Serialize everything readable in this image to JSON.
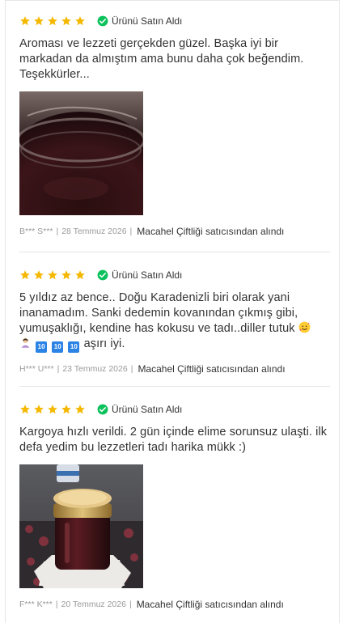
{
  "reviews": [
    {
      "rating": 5,
      "verified_label": "Ürünü Satın Aldı",
      "comment": "Aroması ve lezzeti gerçekden güzel. Başka iyi bir markadan da almıştım ama bunu daha çok beğendim. Teşekkürler...",
      "has_photo": true,
      "user": "B*** S***",
      "date": "28 Temmuz 2026",
      "seller": "Macahel Çiftliği satıcısından alındı"
    },
    {
      "rating": 5,
      "verified_label": "Ürünü Satın Aldı",
      "comment_text": "5 yıldız az bence.. Doğu Karadenizli biri olarak yani inanamadım. Sanki dedemin kovanından çıkmış gibi, yumuşaklığı, kendine has kokusu ve tadı..diller tutuk",
      "comment_tail": "aşırı iyi.",
      "emoji_ten": "10",
      "has_photo": false,
      "user": "H*** U***",
      "date": "23 Temmuz 2026",
      "seller": "Macahel Çiftliği satıcısından alındı"
    },
    {
      "rating": 5,
      "verified_label": "Ürünü Satın Aldı",
      "comment": "Kargoya hızlı verildi. 2 gün içinde elime sorunsuz ulaşti. ilk defa yedim bu lezzetleri tadı harika mükk :)",
      "has_photo": true,
      "user": "F*** K***",
      "date": "20 Temmuz 2026",
      "seller": "Macahel Çiftliği satıcısından alındı"
    }
  ],
  "colors": {
    "star": "#F5B800",
    "verified": "#0BC15C",
    "text": "#333333",
    "muted": "#999999",
    "divider": "#E6E6E6"
  }
}
